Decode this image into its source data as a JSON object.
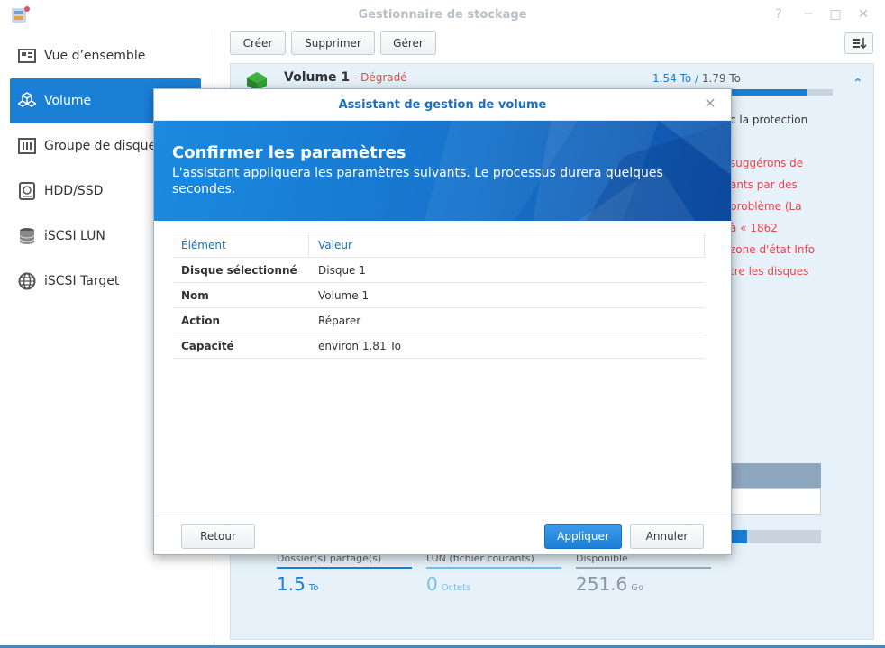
{
  "window": {
    "title": "Gestionnaire de stockage"
  },
  "sidebar": {
    "items": [
      {
        "label": "Vue d’ensemble",
        "icon": "overview-icon"
      },
      {
        "label": "Volume",
        "icon": "volume-cubes-icon",
        "active": true
      },
      {
        "label": "Groupe de disques",
        "icon": "disk-group-icon"
      },
      {
        "label": "HDD/SSD",
        "icon": "hdd-icon"
      },
      {
        "label": "iSCSI LUN",
        "icon": "lun-icon"
      },
      {
        "label": "iSCSI Target",
        "icon": "globe-icon"
      }
    ]
  },
  "toolbar": {
    "create_label": "Créer",
    "delete_label": "Supprimer",
    "manage_label": "Gérer"
  },
  "volume": {
    "name": "Volume 1",
    "separator": " - ",
    "status": "Dégradé",
    "used": "1.54 To",
    "total": "1.79 To",
    "usage_fraction": 0.86,
    "description_lines": [
      "c la protection",
      "suggérons de",
      "ants par des",
      " problème (La",
      " à « 1862",
      "zone d'état Info",
      "tre les disques"
    ],
    "stats": [
      {
        "label": "Dossier(s) partagé(s)",
        "value": "1.5",
        "unit": "To"
      },
      {
        "label": "LUN (fichier courants)",
        "value": "0",
        "unit": "Octets"
      },
      {
        "label": "Disponible",
        "value": "251.6",
        "unit": "Go"
      }
    ]
  },
  "dialog": {
    "title": "Assistant de gestion de volume",
    "heading": "Confirmer les paramètres",
    "subtitle": "L'assistant appliquera les paramètres suivants. Le processus durera quelques secondes.",
    "columns": {
      "item": "Élément",
      "value": "Valeur"
    },
    "rows": [
      {
        "item": "Disque sélectionné",
        "value": "Disque 1"
      },
      {
        "item": "Nom",
        "value": "Volume 1"
      },
      {
        "item": "Action",
        "value": "Réparer"
      },
      {
        "item": "Capacité",
        "value": "environ 1.81 To"
      }
    ],
    "back_label": "Retour",
    "apply_label": "Appliquer",
    "cancel_label": "Annuler"
  },
  "colors": {
    "accent": "#1b7fd6",
    "error": "#e54848"
  }
}
